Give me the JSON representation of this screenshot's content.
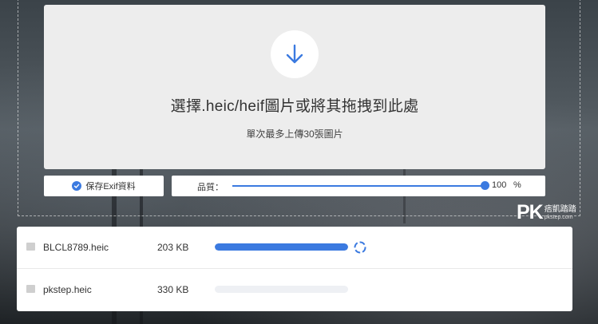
{
  "dropzone": {
    "title": "選擇.heic/heif圖片或將其拖拽到此處",
    "subtitle": "單次最多上傳30張圖片",
    "icon": "download-arrow-icon"
  },
  "options": {
    "exif_label": "保存Exif資料",
    "exif_checked": true,
    "quality_label": "品質：",
    "quality_value": "100",
    "quality_unit": "%"
  },
  "watermark": {
    "logo_text": "PK",
    "site_name": "痞凱踏踏",
    "url": "pkstep.com"
  },
  "files": [
    {
      "name": "BLCL8789.heic",
      "size": "203 KB",
      "progress": 1.0,
      "status": "processing"
    },
    {
      "name": "pkstep.heic",
      "size": "330 KB",
      "progress": 0.0,
      "status": "queued"
    }
  ],
  "colors": {
    "accent": "#3b7ae0",
    "panel": "#ededed",
    "track": "#eef0f4"
  }
}
